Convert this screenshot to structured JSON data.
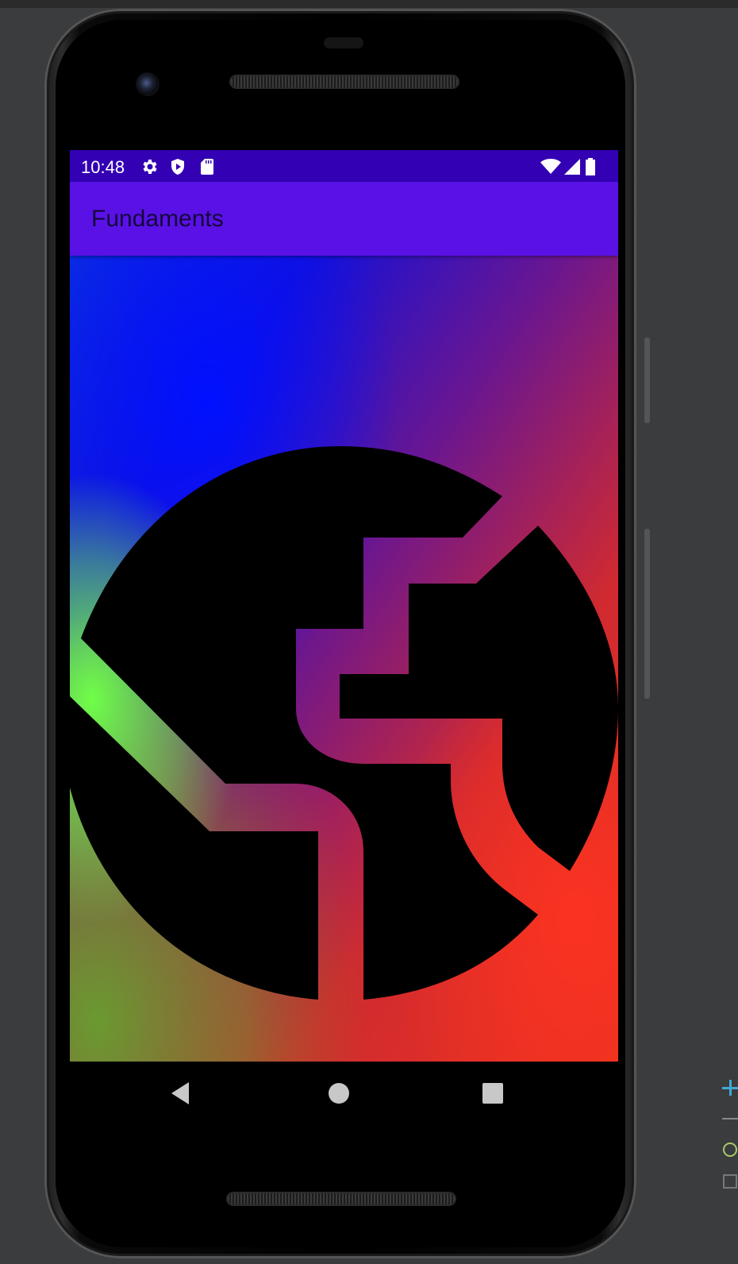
{
  "status_bar": {
    "time": "10:48",
    "left_icons": [
      "gear-icon",
      "shield-play-icon",
      "sd-card-icon"
    ],
    "right_icons": [
      "wifi-icon",
      "cell-signal-icon",
      "battery-icon"
    ]
  },
  "app_bar": {
    "title": "Fundaments"
  },
  "content": {
    "image": "globe-icon",
    "gradient_colors": [
      "#0010ff",
      "#3a10c0",
      "#7a1880",
      "#e83020",
      "#70ff48",
      "#6a9a30"
    ]
  },
  "nav_bar": {
    "buttons": [
      "back",
      "home",
      "recents"
    ]
  },
  "colors": {
    "status_bar": "#3300b3",
    "app_bar": "#5a11e6",
    "title_text": "#14063a"
  }
}
